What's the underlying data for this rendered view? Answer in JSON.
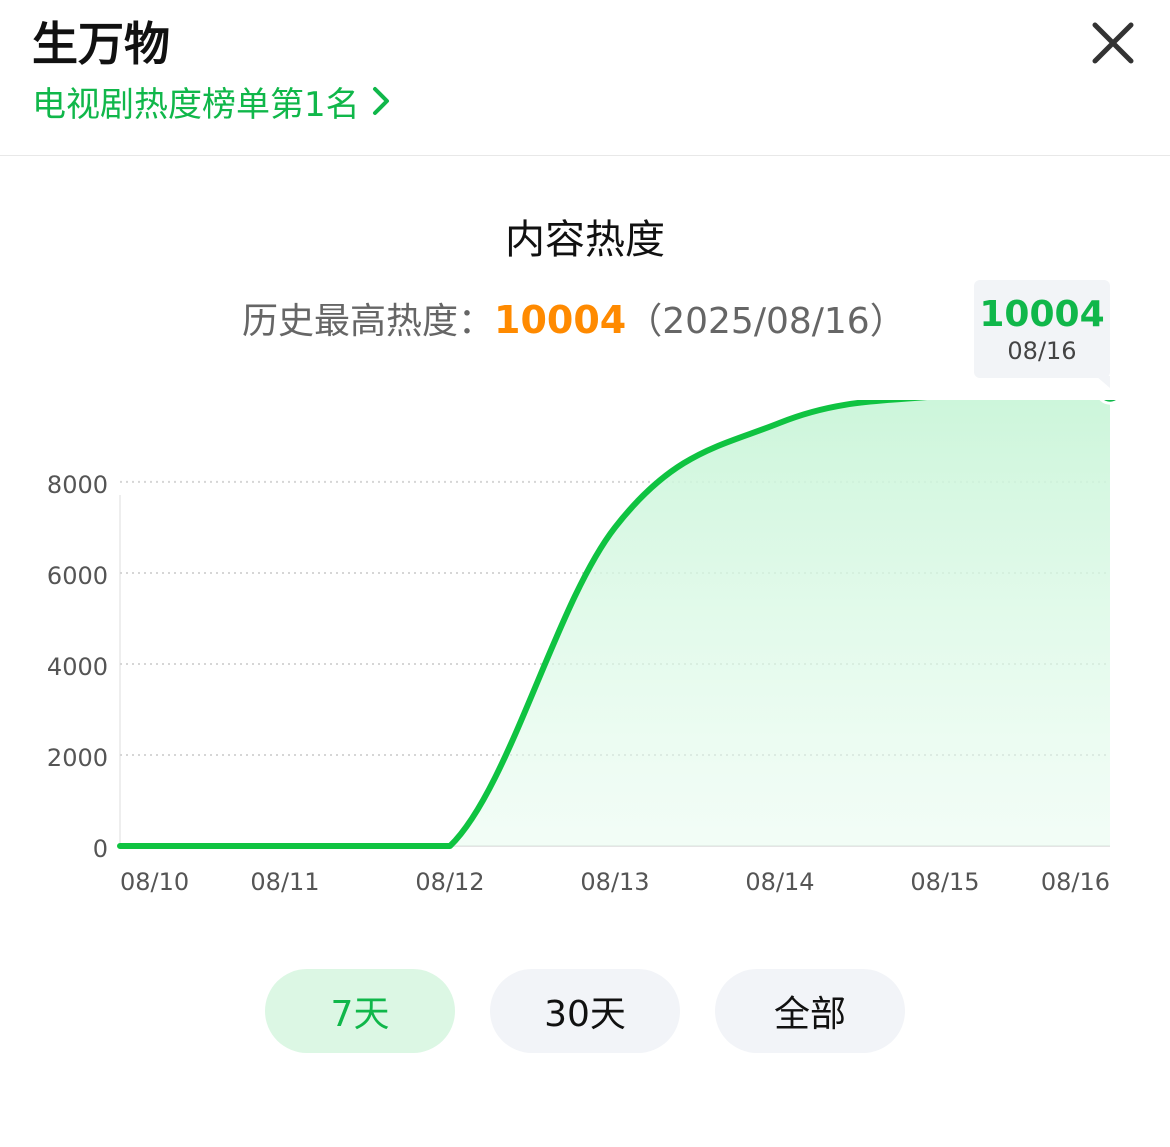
{
  "header": {
    "title": "生万物",
    "rank_link": "电视剧热度榜单第1名"
  },
  "section": {
    "title": "内容热度",
    "peak_label": "历史最高热度：",
    "peak_value": "10004",
    "peak_date": "（2025/08/16）"
  },
  "tooltip": {
    "value": "10004",
    "date": "08/16"
  },
  "chart_data": {
    "type": "area",
    "x": [
      "08/10",
      "08/11",
      "08/12",
      "08/13",
      "08/14",
      "08/15",
      "08/16"
    ],
    "y_ticks": [
      0,
      2000,
      4000,
      6000,
      8000
    ],
    "ylim": [
      0,
      9800
    ],
    "grid": true,
    "series": [
      {
        "values": [
          0,
          0,
          0,
          7000,
          9300,
          9900,
          10004
        ],
        "color": "#0fc341"
      }
    ]
  },
  "range_buttons": [
    {
      "label": "7天",
      "active": true
    },
    {
      "label": "30天",
      "active": false
    },
    {
      "label": "全部",
      "active": false
    }
  ],
  "colors": {
    "accent": "#10b74a",
    "peak": "#ff8a00",
    "line": "#0fc341"
  }
}
